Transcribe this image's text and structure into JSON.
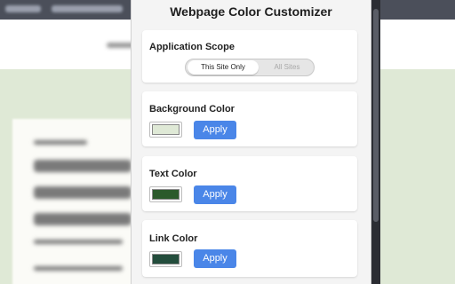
{
  "popup": {
    "title": "Webpage Color Customizer",
    "scope": {
      "label": "Application Scope",
      "options": [
        "This Site Only",
        "All Sites"
      ],
      "selected": "This Site Only"
    },
    "background_color": {
      "label": "Background Color",
      "value": "#dfe9d6",
      "button": "Apply"
    },
    "text_color": {
      "label": "Text Color",
      "value": "#2b5a2b",
      "button": "Apply"
    },
    "link_color": {
      "label": "Link Color",
      "value": "#234d3c",
      "button": "Apply"
    }
  },
  "colors": {
    "accent": "#4a86e8",
    "page_background": "#dfe9d6",
    "topbar": "#4b4f5a"
  }
}
